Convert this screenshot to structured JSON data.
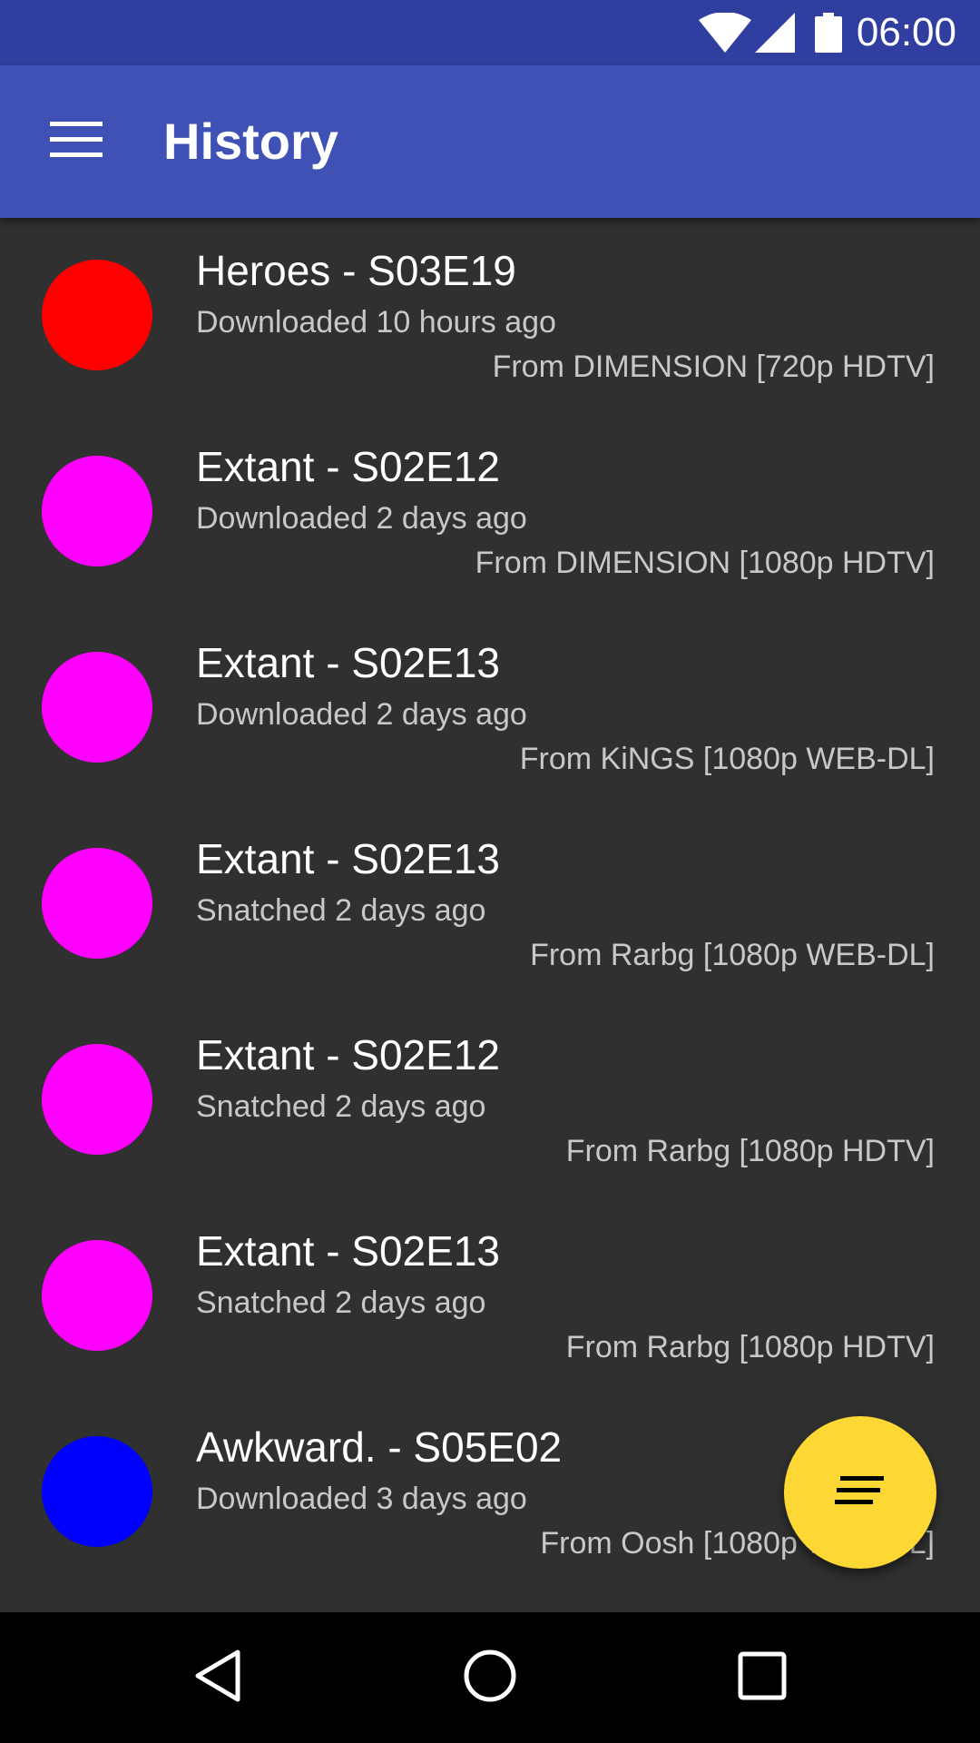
{
  "status_bar": {
    "time": "06:00",
    "icons": [
      "wifi-icon",
      "cell-signal-icon",
      "battery-icon"
    ]
  },
  "app_bar": {
    "title": "History",
    "menu_icon": "hamburger-menu-icon"
  },
  "history": [
    {
      "title": "Heroes - S03E19",
      "status": "Downloaded 10 hours ago",
      "source": "From DIMENSION [720p HDTV]",
      "color": "#ff0000"
    },
    {
      "title": "Extant - S02E12",
      "status": "Downloaded 2 days ago",
      "source": "From DIMENSION [1080p HDTV]",
      "color": "#ff00ff"
    },
    {
      "title": "Extant - S02E13",
      "status": "Downloaded 2 days ago",
      "source": "From KiNGS [1080p WEB-DL]",
      "color": "#ff00ff"
    },
    {
      "title": "Extant - S02E13",
      "status": "Snatched 2 days ago",
      "source": "From Rarbg [1080p WEB-DL]",
      "color": "#ff00ff"
    },
    {
      "title": "Extant - S02E12",
      "status": "Snatched 2 days ago",
      "source": "From Rarbg [1080p HDTV]",
      "color": "#ff00ff"
    },
    {
      "title": "Extant - S02E13",
      "status": "Snatched 2 days ago",
      "source": "From Rarbg [1080p HDTV]",
      "color": "#ff00ff"
    },
    {
      "title": "Awkward. - S05E02",
      "status": "Downloaded 3 days ago",
      "source": "From Oosh [1080p WEB-DL]",
      "color": "#0000ff"
    }
  ],
  "fab": {
    "icon": "sort-icon",
    "color": "#fdd835"
  },
  "nav_bar": {
    "icons": [
      "back-icon",
      "home-icon",
      "recents-icon"
    ]
  },
  "colors": {
    "primary": "#3f51b5",
    "primary_dark": "#303f9f",
    "background": "#303030",
    "accent": "#fdd835"
  }
}
